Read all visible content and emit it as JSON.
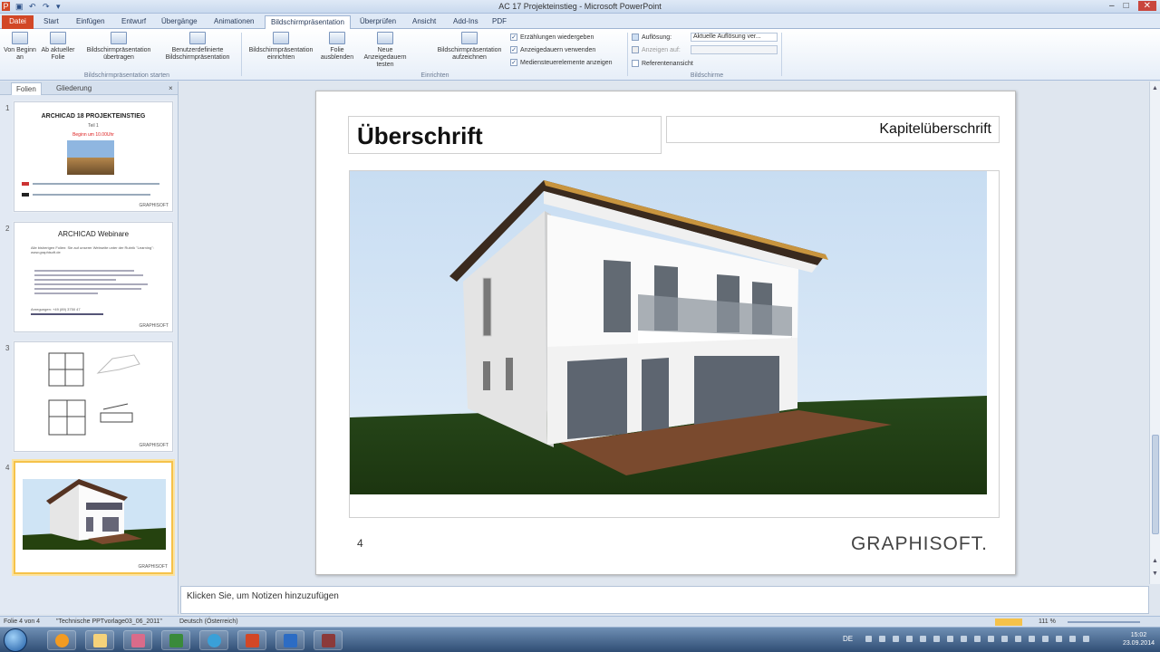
{
  "window": {
    "title": "AC 17 Projekteinstieg - Microsoft PowerPoint",
    "controls": [
      "–",
      "□",
      "✕"
    ]
  },
  "tabs": [
    "Datei",
    "Start",
    "Einfügen",
    "Entwurf",
    "Übergänge",
    "Animationen",
    "Bildschirmpräsentation",
    "Überprüfen",
    "Ansicht",
    "Add-Ins",
    "PDF"
  ],
  "active_tab": "Bildschirmpräsentation",
  "ribbon": {
    "start_buttons": [
      "Von Beginn an",
      "Ab aktueller Folie",
      "Bildschirmpräsentation übertragen",
      "Benutzerdefinierte Bildschirmpräsentation"
    ],
    "group1_label": "Bildschirmpräsentation starten",
    "setup_buttons": [
      "Bildschirmpräsentation einrichten",
      "Folie ausblenden",
      "Neue Anzeigedauern testen",
      "Bildschirmpräsentation aufzeichnen"
    ],
    "checkboxes": [
      "Erzählungen wiedergeben",
      "Anzeigedauern verwenden",
      "Mediensteuerelemente anzeigen"
    ],
    "group2_label": "Einrichten",
    "monitor": {
      "resolution_label": "Auflösung:",
      "resolution_value": "Aktuelle Auflösung ver...",
      "show_on": "Anzeigen auf:",
      "presenter_view": "Referentenansicht"
    },
    "group3_label": "Bildschirme"
  },
  "panel": {
    "tab_slides": "Folien",
    "tab_outline": "Gliederung",
    "close": "×"
  },
  "thumbnails": [
    {
      "num": "1",
      "title": "ARCHICAD 18 PROJEKTEINSTIEG",
      "sub": "Teil 1",
      "red": "Beginn um 10.00Uhr",
      "brand": "GRAPHISOFT"
    },
    {
      "num": "2",
      "title": "ARCHICAD Webinare",
      "text1": "Alle bisherigen Folien: Sie auf unserer Webseite unter der Rubrik \"Learning\": www.graphisoft.de",
      "text2": "Anregungen: +49 (89) 3750 47",
      "brand": "GRAPHISOFT"
    },
    {
      "num": "3",
      "brand": "GRAPHISOFT"
    },
    {
      "num": "4",
      "brand": "GRAPHISOFT"
    }
  ],
  "slide": {
    "title": "Überschrift",
    "chapter": "Kapitelüberschrift",
    "page": "4",
    "brand": "GRAPHISOFT."
  },
  "notes_placeholder": "Klicken Sie, um Notizen hinzuzufügen",
  "statusbar": {
    "slide": "Folie 4 von 4",
    "theme": "\"Technische PPTvorlage03_06_2011\"",
    "language": "Deutsch (Österreich)",
    "zoom": "111 %"
  },
  "clock": {
    "time": "15:02",
    "date": "23.09.2014"
  },
  "tray": {
    "lang": "DE"
  }
}
